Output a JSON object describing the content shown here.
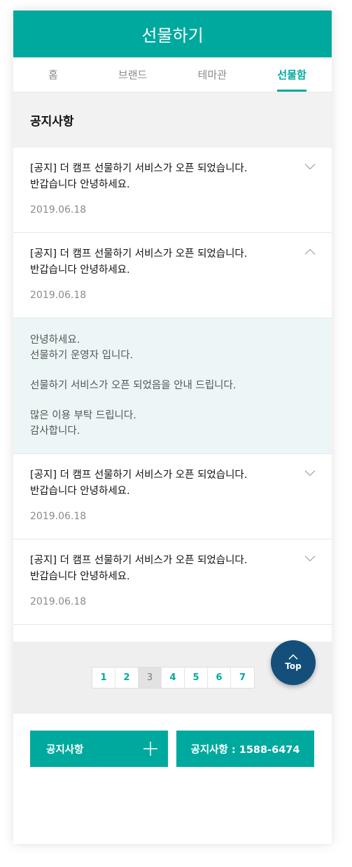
{
  "theme": {
    "accent": "#00a99e",
    "top_button_color": "#134f7a"
  },
  "header": {
    "title": "선물하기"
  },
  "tabs": [
    {
      "label": "홈",
      "active": false
    },
    {
      "label": "브랜드",
      "active": false
    },
    {
      "label": "테마관",
      "active": false
    },
    {
      "label": "선물함",
      "active": true
    }
  ],
  "section": {
    "title": "공지사항"
  },
  "notices": [
    {
      "line1": "[공지] 더 캠프 선물하기 서비스가 오픈 되었습니다.",
      "line2": "반갑습니다 안녕하세요.",
      "date": "2019.06.18",
      "expanded": false
    },
    {
      "line1": "[공지] 더 캠프 선물하기 서비스가 오픈 되었습니다.",
      "line2": "반갑습니다 안녕하세요.",
      "date": "2019.06.18",
      "expanded": true
    },
    {
      "line1": "[공지] 더 캠프 선물하기 서비스가 오픈 되었습니다.",
      "line2": "반갑습니다 안녕하세요.",
      "date": "2019.06.18",
      "expanded": false
    },
    {
      "line1": "[공지] 더 캠프 선물하기 서비스가 오픈 되었습니다.",
      "line2": "반갑습니다 안녕하세요.",
      "date": "2019.06.18",
      "expanded": false
    }
  ],
  "detail": {
    "lines": [
      "안녕하세요.",
      "선물하기 운영자 입니다.",
      "",
      "선물하기 서비스가 오픈 되었음을 안내 드립니다.",
      "",
      "많은 이용 부탁 드립니다.",
      "감사합니다."
    ]
  },
  "pagination": {
    "pages": [
      "1",
      "2",
      "3",
      "4",
      "5",
      "6",
      "7"
    ],
    "current": "3"
  },
  "top_button": {
    "label": "Top"
  },
  "footer": {
    "notice_button": "공지사항",
    "contact_button": "공지사항 : 1588-6474"
  }
}
